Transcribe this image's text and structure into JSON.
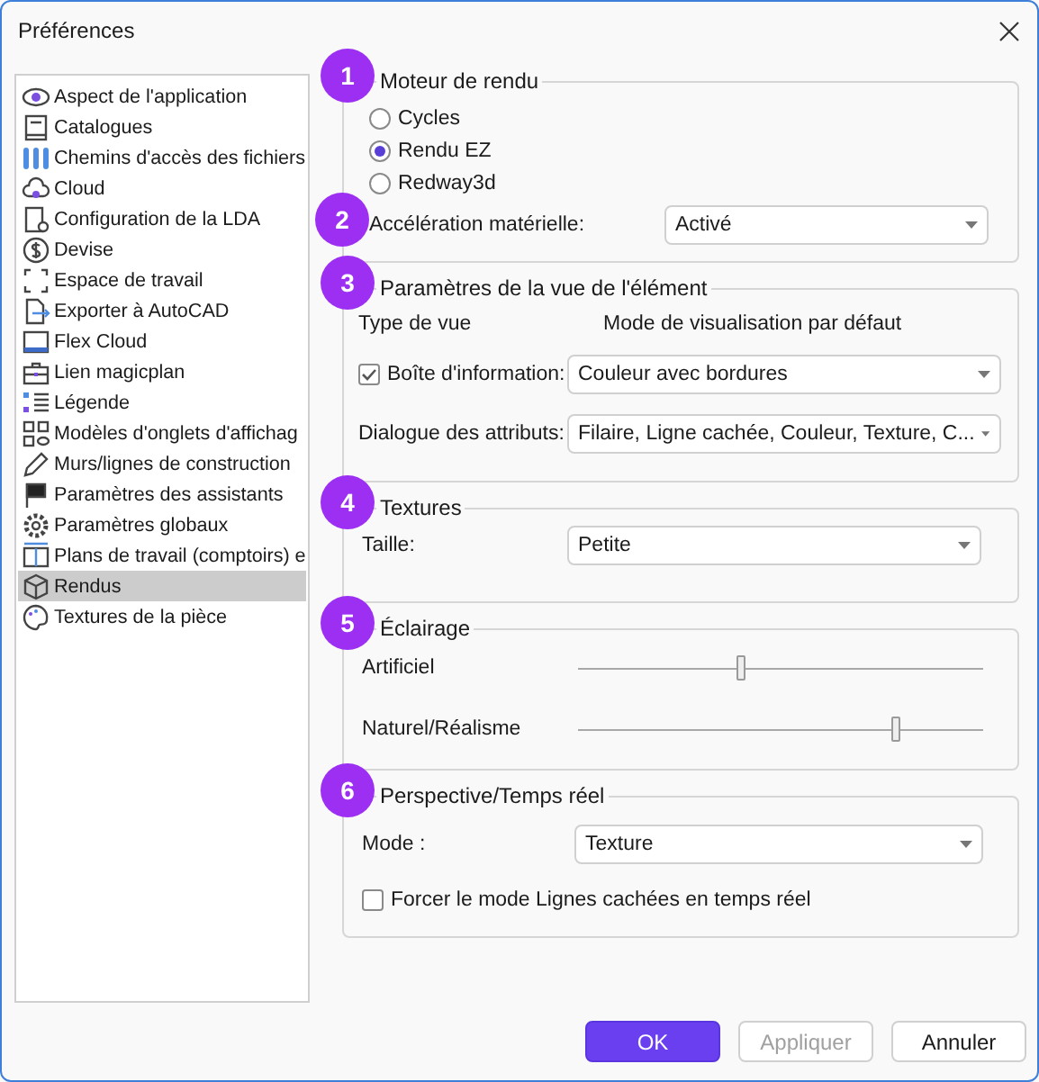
{
  "window": {
    "title": "Préférences"
  },
  "sidebar": {
    "items": [
      {
        "label": "Aspect de l'application",
        "selected": false
      },
      {
        "label": "Catalogues",
        "selected": false
      },
      {
        "label": "Chemins d'accès des fichiers",
        "selected": false
      },
      {
        "label": "Cloud",
        "selected": false
      },
      {
        "label": "Configuration de la LDA",
        "selected": false
      },
      {
        "label": "Devise",
        "selected": false
      },
      {
        "label": "Espace de travail",
        "selected": false
      },
      {
        "label": "Exporter à AutoCAD",
        "selected": false
      },
      {
        "label": "Flex Cloud",
        "selected": false
      },
      {
        "label": "Lien magicplan",
        "selected": false
      },
      {
        "label": "Légende",
        "selected": false
      },
      {
        "label": "Modèles d'onglets d'affichag",
        "selected": false
      },
      {
        "label": "Murs/lignes de construction",
        "selected": false
      },
      {
        "label": "Paramètres des assistants",
        "selected": false
      },
      {
        "label": "Paramètres globaux",
        "selected": false
      },
      {
        "label": "Plans de travail (comptoirs) e",
        "selected": false
      },
      {
        "label": "Rendus",
        "selected": true
      },
      {
        "label": "Textures de la pièce",
        "selected": false
      }
    ]
  },
  "sections": [
    {
      "badge": "1",
      "title": "Moteur de rendu",
      "rows": [
        {
          "kind": "radio",
          "label": "Cycles",
          "selected": false
        },
        {
          "kind": "radio",
          "label": "Rendu EZ",
          "selected": true
        },
        {
          "kind": "radio",
          "label": "Redway3d",
          "selected": false
        },
        {
          "kind": "select",
          "badge": "2",
          "label": "Accélération matérielle:",
          "value": "Activé"
        }
      ]
    },
    {
      "badge": "3",
      "title": "Paramètres de la vue de l'élément",
      "rows": [
        {
          "kind": "headers",
          "label": "Type de vue",
          "value": "Mode de visualisation par défaut"
        },
        {
          "kind": "check-select",
          "label": "Boîte d'information:",
          "checked": true,
          "value": "Couleur avec bordures"
        },
        {
          "kind": "select",
          "label": "Dialogue des attributs:",
          "value": "Filaire, Ligne cachée, Couleur, Texture, C..."
        }
      ]
    },
    {
      "badge": "4",
      "title": "Textures",
      "rows": [
        {
          "kind": "select",
          "label": "Taille:",
          "value": "Petite"
        }
      ]
    },
    {
      "badge": "5",
      "title": "Éclairage",
      "rows": [
        {
          "kind": "slider",
          "label": "Artificiel",
          "level": 0.4
        },
        {
          "kind": "slider",
          "label": "Naturel/Réalisme",
          "level": 0.78
        }
      ]
    },
    {
      "badge": "6",
      "title": "Perspective/Temps réel",
      "rows": [
        {
          "kind": "select",
          "label": "Mode :",
          "value": "Texture"
        },
        {
          "kind": "checkbox",
          "label": "Forcer le mode Lignes cachées en temps réel",
          "checked": false
        }
      ]
    }
  ],
  "buttons": [
    {
      "label": "OK",
      "kind": "primary",
      "disabled": false
    },
    {
      "label": "Appliquer",
      "kind": "normal",
      "disabled": true
    },
    {
      "label": "Annuler",
      "kind": "normal",
      "disabled": false
    }
  ]
}
